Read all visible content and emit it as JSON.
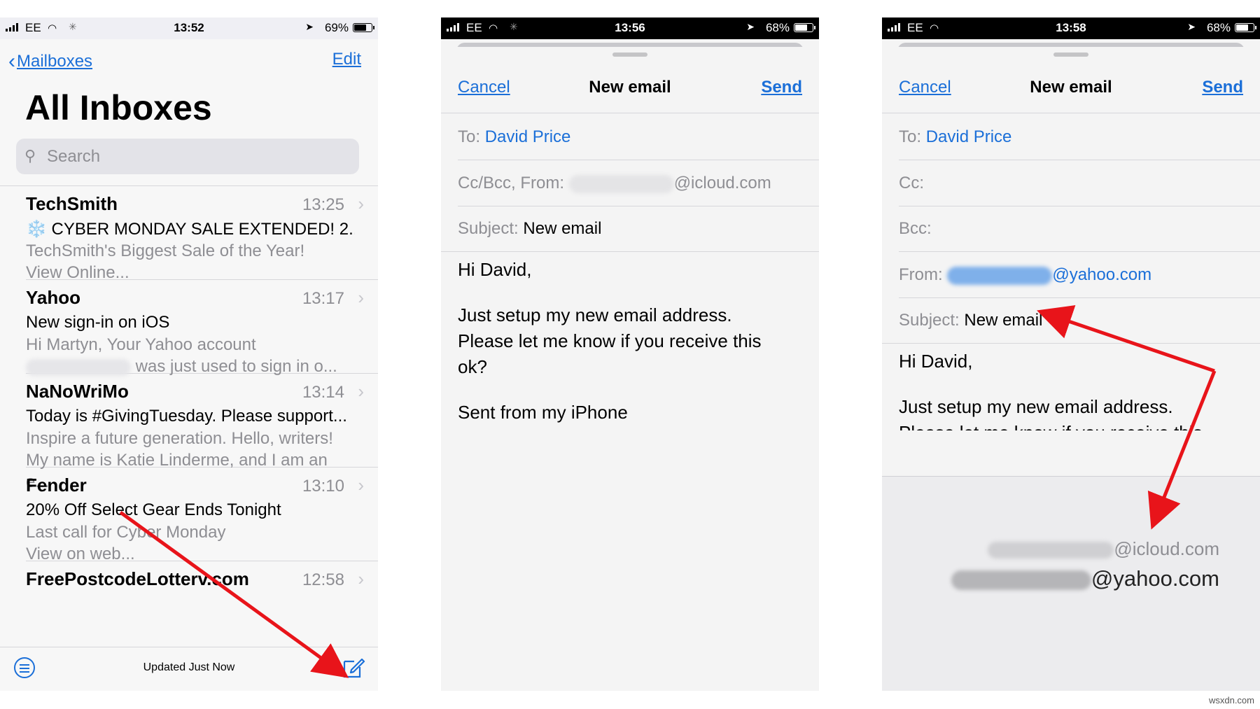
{
  "panel1": {
    "status": {
      "carrier": "EE",
      "time": "13:52",
      "battery": "69%"
    },
    "nav": {
      "back_label": "Mailboxes",
      "edit_label": "Edit"
    },
    "title": "All Inboxes",
    "search": {
      "placeholder": "Search"
    },
    "emails": [
      {
        "sender": "TechSmith",
        "time": "13:25",
        "subject": "❄️ CYBER MONDAY SALE EXTENDED! 2...",
        "preview1": "TechSmith's Biggest Sale of the Year!",
        "preview2": "View Online..."
      },
      {
        "sender": "Yahoo",
        "time": "13:17",
        "subject": "New sign-in on iOS",
        "preview1": "Hi Martyn, Your Yahoo account",
        "preview2": "was just used to sign in o..."
      },
      {
        "sender": "NaNoWriMo",
        "time": "13:14",
        "subject": "Today is #GivingTuesday. Please support...",
        "preview1": "Inspire a future generation. Hello, writers!",
        "preview2": "My name is Katie Linderme, and I am an e..."
      },
      {
        "sender": "Fender",
        "time": "13:10",
        "subject": "20% Off Select Gear Ends Tonight",
        "preview1": "Last call for Cyber Monday",
        "preview2": "View on web..."
      },
      {
        "sender": "FreePostcodeLotterv.com",
        "time": "12:58",
        "subject": "",
        "preview1": "",
        "preview2": ""
      }
    ],
    "toolbar": {
      "status": "Updated Just Now"
    }
  },
  "panel2": {
    "status": {
      "carrier": "EE",
      "time": "13:56",
      "battery": "68%"
    },
    "cancel": "Cancel",
    "title": "New email",
    "send": "Send",
    "to_label": "To:",
    "to_value": "David Price",
    "ccbcc_label": "Cc/Bcc, From:",
    "from_domain": "@icloud.com",
    "subject_label": "Subject:",
    "subject_value": "New email",
    "greeting": "Hi David,",
    "body1": "Just setup my new email address.",
    "body2": "Please let me know if you receive this",
    "body3": "ok?",
    "signature": "Sent from my iPhone"
  },
  "panel3": {
    "status": {
      "carrier": "EE",
      "time": "13:58",
      "battery": "68%"
    },
    "cancel": "Cancel",
    "title": "New email",
    "send": "Send",
    "to_label": "To:",
    "to_value": "David Price",
    "cc_label": "Cc:",
    "bcc_label": "Bcc:",
    "from_label": "From:",
    "from_domain": "@yahoo.com",
    "subject_label": "Subject:",
    "subject_value": "New email",
    "greeting": "Hi David,",
    "body1": "Just setup my new email address.",
    "body2": "Please let me know if you receive this",
    "picker_option1": "@icloud.com",
    "picker_option2": "@yahoo.com"
  },
  "watermark": "wsxdn.com",
  "colors": {
    "ios_blue": "#1b6fd8",
    "arrow_red": "#e8141a"
  }
}
